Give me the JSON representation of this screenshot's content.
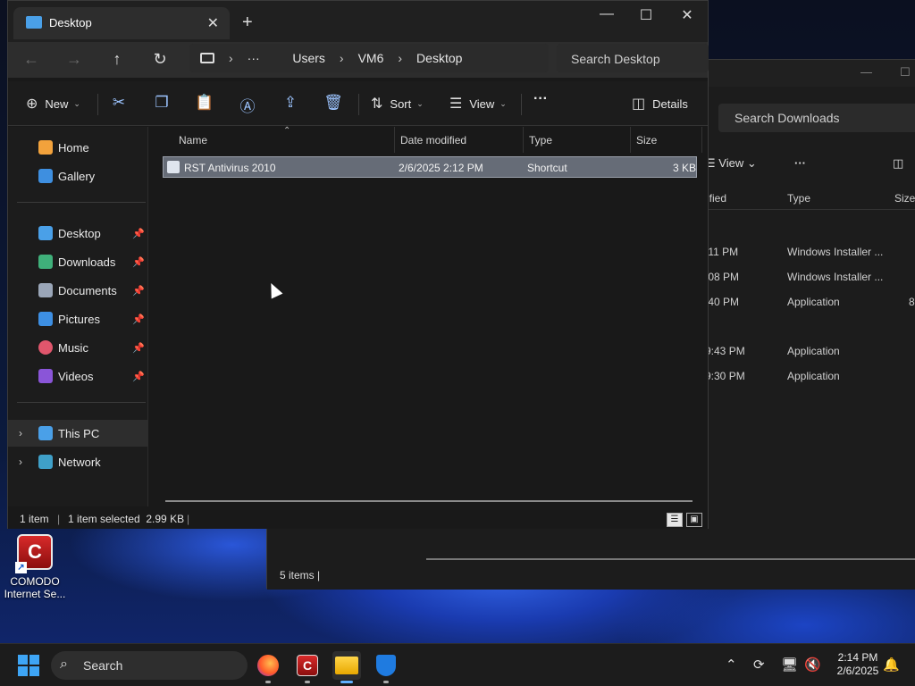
{
  "desktop": {
    "icons": [
      {
        "name": "COMODO Internet Se...",
        "label_line1": "COMODO",
        "label_line2": "Internet Se...",
        "icon": "comodo-icon"
      }
    ]
  },
  "back_window": {
    "search_placeholder": "Search Downloads",
    "view_label": "View",
    "columns": [
      "ified",
      "Type",
      "Size"
    ],
    "rows": [
      {
        "date": ":11 PM",
        "type": "Windows Installer ..."
      },
      {
        "date": ":08 PM",
        "type": "Windows Installer ..."
      },
      {
        "date": ":40 PM",
        "type": "Application",
        "size": "8"
      },
      {
        "date": "9:43 PM",
        "type": "Application"
      },
      {
        "date": "9:30 PM",
        "type": "Application"
      }
    ],
    "status": "5 items"
  },
  "window": {
    "tab_title": "Desktop",
    "address": {
      "crumbs": [
        "Users",
        "VM6",
        "Desktop"
      ],
      "overflow": "···"
    },
    "search_placeholder": "Search Desktop",
    "toolbar": {
      "new_label": "New",
      "sort_label": "Sort",
      "view_label": "View",
      "more_label": "···",
      "details_label": "Details"
    },
    "sidebar": {
      "top": [
        {
          "label": "Home",
          "icon": "home-icon"
        },
        {
          "label": "Gallery",
          "icon": "gallery-icon"
        }
      ],
      "pinned": [
        {
          "label": "Desktop",
          "icon": "desktop-folder-icon"
        },
        {
          "label": "Downloads",
          "icon": "download-icon"
        },
        {
          "label": "Documents",
          "icon": "documents-icon"
        },
        {
          "label": "Pictures",
          "icon": "pictures-icon"
        },
        {
          "label": "Music",
          "icon": "music-icon"
        },
        {
          "label": "Videos",
          "icon": "videos-icon"
        }
      ],
      "drives": [
        {
          "label": "This PC",
          "icon": "this-pc-icon"
        },
        {
          "label": "Network",
          "icon": "network-icon"
        }
      ]
    },
    "columns": {
      "name": "Name",
      "date": "Date modified",
      "type": "Type",
      "size": "Size"
    },
    "files": [
      {
        "name": "RST Antivirus 2010",
        "date": "2/6/2025 2:12 PM",
        "type": "Shortcut",
        "size": "3 KB"
      }
    ],
    "status": {
      "count": "1 item",
      "selected": "1 item selected  2.99 KB"
    }
  },
  "taskbar": {
    "search_label": "Search",
    "apps": [
      "firefox-icon",
      "comodo-icon",
      "file-explorer-icon",
      "defender-icon"
    ],
    "time": "2:14 PM",
    "date": "2/6/2025"
  },
  "colors": {
    "accent": "#3ea5f5",
    "selection": "#666c77"
  }
}
